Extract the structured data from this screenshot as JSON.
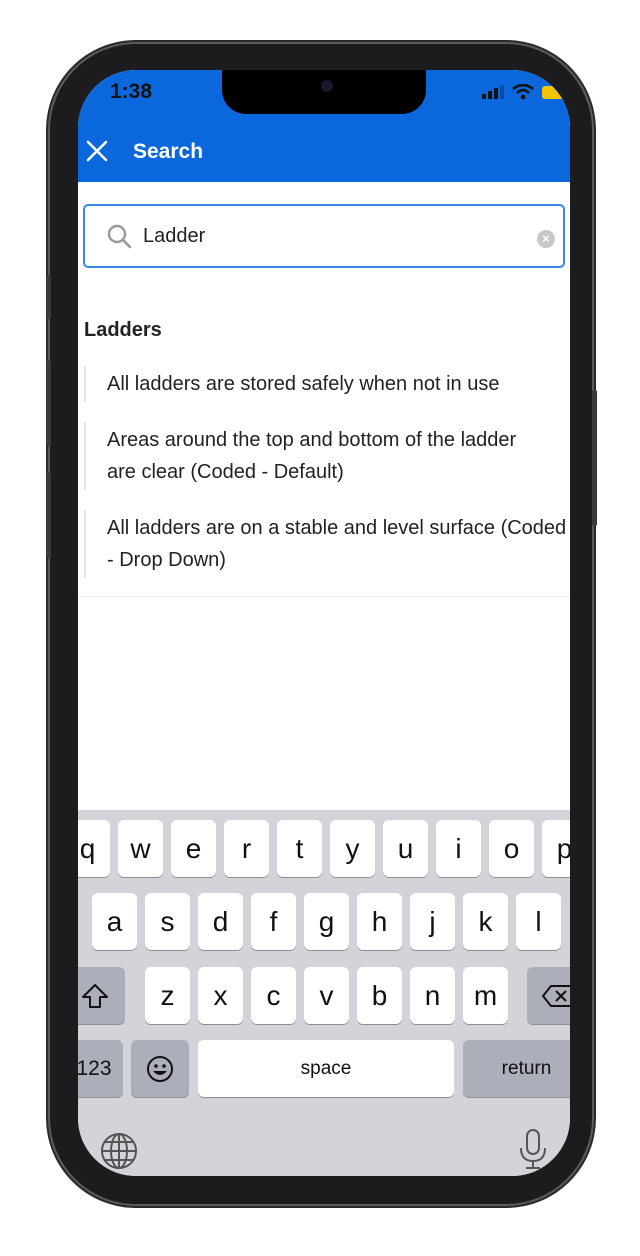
{
  "status_bar": {
    "time": "1:38",
    "battery_color": "#f4c400"
  },
  "header": {
    "title": "Search",
    "close_icon": "close-icon",
    "color": "#0a68dc"
  },
  "search": {
    "value": "Ladder",
    "placeholder": "",
    "icon": "search-icon",
    "clear_icon": "clear-icon"
  },
  "results": {
    "section_title": "Ladders",
    "items": [
      {
        "label": "All ladders are stored safely when not in use"
      },
      {
        "label": "Areas around the top and bottom of the ladder are clear (Coded - Default)"
      },
      {
        "label": "All ladders are on a stable and level surface (Coded - Drop Down)"
      }
    ]
  },
  "keyboard": {
    "row1": [
      "q",
      "w",
      "e",
      "r",
      "t",
      "y",
      "u",
      "i",
      "o",
      "p"
    ],
    "row2": [
      "a",
      "s",
      "d",
      "f",
      "g",
      "h",
      "j",
      "k",
      "l"
    ],
    "row3": [
      "z",
      "x",
      "c",
      "v",
      "b",
      "n",
      "m"
    ],
    "numbers_label": "123",
    "space_label": "space",
    "return_label": "return"
  }
}
